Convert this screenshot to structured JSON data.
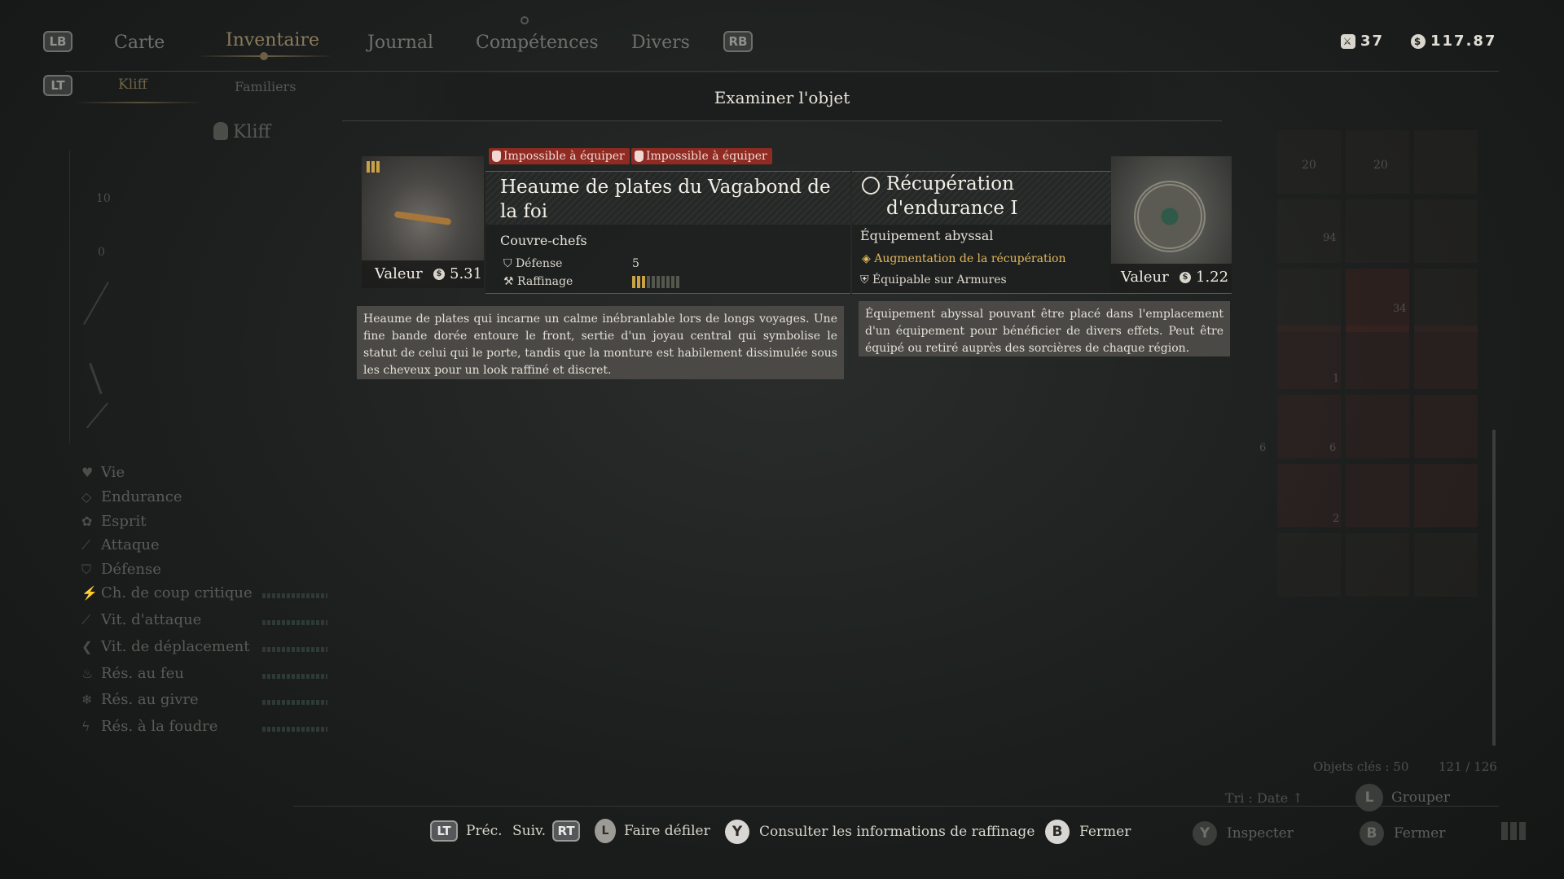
{
  "top_nav": {
    "lb": "LB",
    "rb": "RB",
    "tabs": [
      "Carte",
      "Inventaire",
      "Journal",
      "Compétences",
      "Divers"
    ],
    "active_tab": "Inventaire"
  },
  "sub_nav": {
    "lt": "LT",
    "tabs": [
      "Kliff",
      "Familiers"
    ],
    "active_tab": "Kliff"
  },
  "currency": {
    "tokens": "37",
    "money": "117.87"
  },
  "character": {
    "name": "Kliff",
    "slot_values": [
      "10",
      "0"
    ]
  },
  "stats": [
    {
      "label": "Vie",
      "icon": "heart-icon"
    },
    {
      "label": "Endurance",
      "icon": "diamond-icon"
    },
    {
      "label": "Esprit",
      "icon": "spirit-icon"
    },
    {
      "label": "Attaque",
      "icon": "sword-icon"
    },
    {
      "label": "Défense",
      "icon": "shield-icon"
    },
    {
      "label": "Ch. de coup critique",
      "icon": "critical-icon"
    },
    {
      "label": "Vit. d'attaque",
      "icon": "attack-speed-icon"
    },
    {
      "label": "Vit. de déplacement",
      "icon": "move-speed-icon"
    },
    {
      "label": "Rés. au feu",
      "icon": "fire-icon"
    },
    {
      "label": "Rés. au givre",
      "icon": "frost-icon"
    },
    {
      "label": "Rés. à la foudre",
      "icon": "lightning-icon"
    }
  ],
  "modal": {
    "title": "Examiner l'objet",
    "tags": [
      "Impossible à équiper",
      "Impossible à équiper"
    ],
    "item1": {
      "name": "Heaume de plates du Vagabond de la foi",
      "category": "Couvre-chefs",
      "value_label": "Valeur",
      "value": "5.31",
      "stats": [
        {
          "label": "Défense",
          "value": "5"
        },
        {
          "label": "Raffinage",
          "value": ""
        }
      ],
      "refinement_level": 3,
      "refinement_max": 10,
      "description": "Heaume de plates qui incarne un calme inébranlable lors de longs voyages. Une fine bande dorée entoure le front, sertie d'un joyau central qui symbolise le statut de celui qui le porte, tandis que la monture est habilement dissimulée sous les cheveux pour un look raffiné et discret."
    },
    "item2": {
      "name_line1": "Récupération",
      "name_line2": "d'endurance I",
      "category": "Équipement abyssal",
      "effect": "Augmentation de la récupération",
      "equip": "Équipable sur Armures",
      "value_label": "Valeur",
      "value": "1.22",
      "description": "Équipement abyssal pouvant être placé dans l'emplacement d'un équipement pour bénéficier de divers effets. Peut être équipé ou retiré auprès des sorcières de chaque région."
    }
  },
  "inventory_counts": {
    "top_counts": [
      "20",
      "20",
      "94",
      "34",
      "1",
      "6",
      "6",
      "2"
    ],
    "key_items_label": "Objets clés : 50",
    "slots": "121 / 126",
    "sort_label": "Tri : Date"
  },
  "footer": {
    "lt": "LT",
    "prev": "Préc.",
    "next": "Suiv.",
    "rt": "RT",
    "scroll": "Faire défiler",
    "y": "Y",
    "refine_info": "Consulter les informations de raffinage",
    "b": "B",
    "close": "Fermer",
    "inspect": "Inspecter",
    "close2": "Fermer",
    "group": "Grouper",
    "l": "L"
  },
  "colors": {
    "accent_gold": "#e2b85a",
    "warning_red": "#8f2b22",
    "active_tab": "#8b7a5a"
  }
}
